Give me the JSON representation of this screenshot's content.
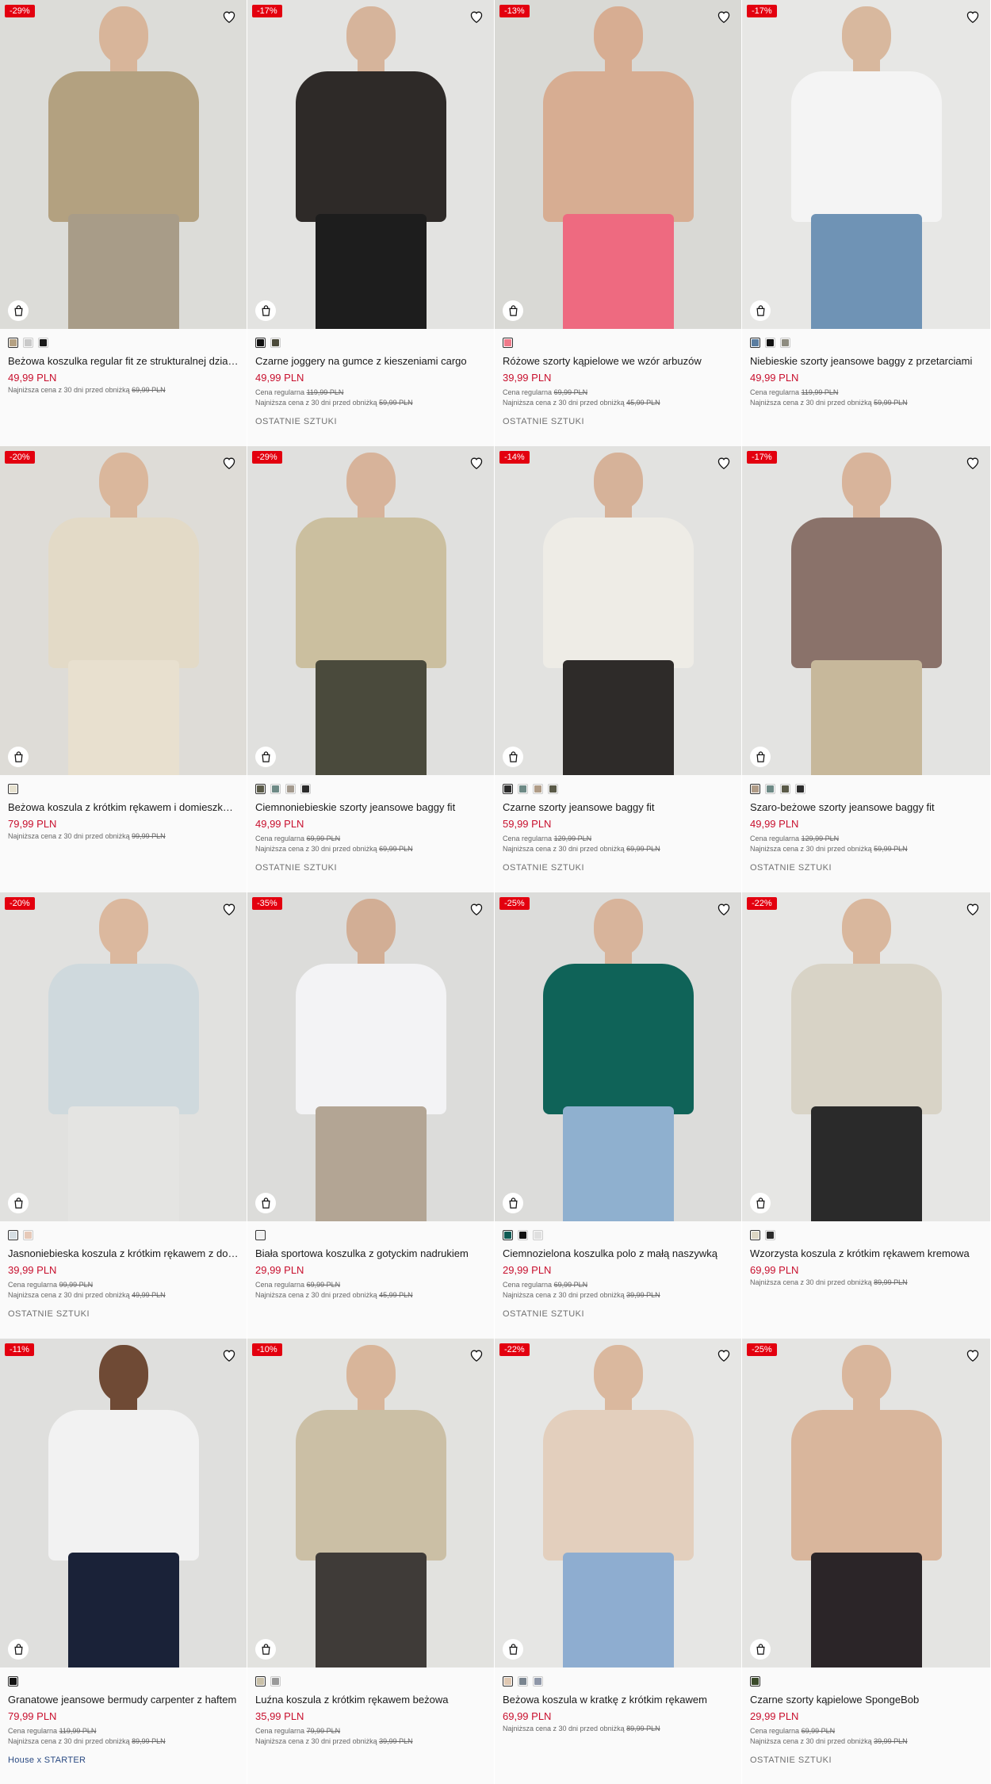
{
  "products": [
    {
      "badge": "-29%",
      "name": "Beżowa koszulka regular fit ze strukturalnej dzianiny",
      "price": "49,99 PLN",
      "regular_label": "",
      "regular_price": "",
      "lowest_label": "Najniższa cena z 30 dni przed obniżką",
      "lowest_price": "69,99 PLN",
      "tag": "",
      "tag_kind": "",
      "swatches": [
        "#b5a183",
        "#c9c9c9",
        "#1a1a1a"
      ],
      "bg": "#dcdcd8",
      "top": "#b3a180",
      "bottom": "#a89c88",
      "skin": "#d8b59a"
    },
    {
      "badge": "-17%",
      "name": "Czarne joggery na gumce z kieszeniami cargo",
      "price": "49,99 PLN",
      "regular_label": "Cena regularna",
      "regular_price": "119,99 PLN",
      "lowest_label": "Najniższa cena z 30 dni przed obniżką",
      "lowest_price": "59,99 PLN",
      "tag": "OSTATNIE SZTUKI",
      "tag_kind": "tag",
      "swatches": [
        "#111111",
        "#4b4a3a"
      ],
      "bg": "#e3e3e1",
      "top": "#2e2a28",
      "bottom": "#1d1d1d",
      "skin": "#d6b49b"
    },
    {
      "badge": "-13%",
      "name": "Różowe szorty kąpielowe we wzór arbuzów",
      "price": "39,99 PLN",
      "regular_label": "Cena regularna",
      "regular_price": "69,99 PLN",
      "lowest_label": "Najniższa cena z 30 dni przed obniżką",
      "lowest_price": "45,99 PLN",
      "tag": "OSTATNIE SZTUKI",
      "tag_kind": "tag",
      "swatches": [
        "#f07a8a"
      ],
      "bg": "#d9d9d5",
      "top": "#d7ad92",
      "bottom": "#ee6a80",
      "skin": "#d7ad92"
    },
    {
      "badge": "-17%",
      "name": "Niebieskie szorty jeansowe baggy z przetarciami",
      "price": "49,99 PLN",
      "regular_label": "Cena regularna",
      "regular_price": "119,99 PLN",
      "lowest_label": "Najniższa cena z 30 dni przed obniżką",
      "lowest_price": "59,99 PLN",
      "tag": "",
      "tag_kind": "",
      "swatches": [
        "#5a7da0",
        "#111111",
        "#8e8c80"
      ],
      "bg": "#e7e7e5",
      "top": "#f4f4f4",
      "bottom": "#6f93b5",
      "skin": "#d8b89e"
    },
    {
      "badge": "-20%",
      "name": "Beżowa koszula z krótkim rękawem i domieszką lnu",
      "price": "79,99 PLN",
      "regular_label": "",
      "regular_price": "",
      "lowest_label": "Najniższa cena z 30 dni przed obniżką",
      "lowest_price": "99,99 PLN",
      "tag": "",
      "tag_kind": "",
      "swatches": [
        "#e6e1cf"
      ],
      "bg": "#dedcd7",
      "top": "#e3dac7",
      "bottom": "#e8e0cf",
      "skin": "#dab79c"
    },
    {
      "badge": "-29%",
      "name": "Ciemnoniebieskie szorty jeansowe baggy fit",
      "price": "49,99 PLN",
      "regular_label": "Cena regularna",
      "regular_price": "69,99 PLN",
      "lowest_label": "Najniższa cena z 30 dni przed obniżką",
      "lowest_price": "69,99 PLN",
      "tag": "OSTATNIE SZTUKI",
      "tag_kind": "tag",
      "swatches": [
        "#5a5a48",
        "#6e8a86",
        "#a49a8e",
        "#2b2b2b"
      ],
      "bg": "#e0e0de",
      "top": "#cbbf9f",
      "bottom": "#4a4a3c",
      "skin": "#d7b39a"
    },
    {
      "badge": "-14%",
      "name": "Czarne szorty jeansowe baggy fit",
      "price": "59,99 PLN",
      "regular_label": "Cena regularna",
      "regular_price": "129,99 PLN",
      "lowest_label": "Najniższa cena z 30 dni przed obniżką",
      "lowest_price": "69,99 PLN",
      "tag": "OSTATNIE SZTUKI",
      "tag_kind": "tag",
      "swatches": [
        "#2b2b2b",
        "#6e8a86",
        "#b09c87",
        "#5a5a48"
      ],
      "bg": "#e2e2e0",
      "top": "#eeece6",
      "bottom": "#2e2b29",
      "skin": "#d6b299"
    },
    {
      "badge": "-17%",
      "name": "Szaro-beżowe szorty jeansowe baggy fit",
      "price": "49,99 PLN",
      "regular_label": "Cena regularna",
      "regular_price": "129,99 PLN",
      "lowest_label": "Najniższa cena z 30 dni przed obniżką",
      "lowest_price": "59,99 PLN",
      "tag": "OSTATNIE SZTUKI",
      "tag_kind": "tag",
      "swatches": [
        "#b09c87",
        "#6e8a86",
        "#5a5a48",
        "#2b2b2b"
      ],
      "bg": "#e3e3e1",
      "top": "#8a726a",
      "bottom": "#c7b89b",
      "skin": "#d8b49b"
    },
    {
      "badge": "-20%",
      "name": "Jasnoniebieska koszula z krótkim rękawem z domieszką lnu",
      "price": "39,99 PLN",
      "regular_label": "Cena regularna",
      "regular_price": "99,99 PLN",
      "lowest_label": "Najniższa cena z 30 dni przed obniżką",
      "lowest_price": "49,99 PLN",
      "tag": "OSTATNIE SZTUKI",
      "tag_kind": "tag",
      "swatches": [
        "#d5dde2",
        "#e6c9b8"
      ],
      "bg": "#e1e1df",
      "top": "#cfd9dd",
      "bottom": "#e4e4e2",
      "skin": "#dbb89e"
    },
    {
      "badge": "-35%",
      "name": "Biała sportowa koszulka z gotyckim nadrukiem",
      "price": "29,99 PLN",
      "regular_label": "Cena regularna",
      "regular_price": "69,99 PLN",
      "lowest_label": "Najniższa cena z 30 dni przed obniżką",
      "lowest_price": "45,99 PLN",
      "tag": "",
      "tag_kind": "",
      "swatches": [
        "#f1f1f1"
      ],
      "bg": "#dcdcda",
      "top": "#f3f3f5",
      "bottom": "#b3a594",
      "skin": "#d2ae95"
    },
    {
      "badge": "-25%",
      "name": "Ciemnozielona koszulka polo z małą naszywką",
      "price": "29,99 PLN",
      "regular_label": "Cena regularna",
      "regular_price": "69,99 PLN",
      "lowest_label": "Najniższa cena z 30 dni przed obniżką",
      "lowest_price": "39,99 PLN",
      "tag": "OSTATNIE SZTUKI",
      "tag_kind": "tag",
      "swatches": [
        "#0f5a54",
        "#111111",
        "#e0e0e0"
      ],
      "bg": "#dcdcda",
      "top": "#0f6358",
      "bottom": "#8fb0cf",
      "skin": "#d8b49b"
    },
    {
      "badge": "-22%",
      "name": "Wzorzysta koszula z krótkim rękawem kremowa",
      "price": "69,99 PLN",
      "regular_label": "",
      "regular_price": "",
      "lowest_label": "Najniższa cena z 30 dni przed obniżką",
      "lowest_price": "89,99 PLN",
      "tag": "",
      "tag_kind": "",
      "swatches": [
        "#dcd6c4",
        "#2b2b2b"
      ],
      "bg": "#e6e6e4",
      "top": "#d8d3c6",
      "bottom": "#2a2a2a",
      "skin": "#d9b79d"
    },
    {
      "badge": "-11%",
      "name": "Granatowe jeansowe bermudy carpenter z haftem",
      "price": "79,99 PLN",
      "regular_label": "Cena regularna",
      "regular_price": "119,99 PLN",
      "lowest_label": "Najniższa cena z 30 dni przed obniżką",
      "lowest_price": "89,99 PLN",
      "tag": "House x STARTER",
      "tag_kind": "brand",
      "swatches": [
        "#111111"
      ],
      "bg": "#dfdfdd",
      "top": "#f2f2f2",
      "bottom": "#1a2238",
      "skin": "#6f4a35"
    },
    {
      "badge": "-10%",
      "name": "Luźna koszula z krótkim rękawem beżowa",
      "price": "35,99 PLN",
      "regular_label": "Cena regularna",
      "regular_price": "79,99 PLN",
      "lowest_label": "Najniższa cena z 30 dni przed obniżką",
      "lowest_price": "39,99 PLN",
      "tag": "",
      "tag_kind": "",
      "swatches": [
        "#c9c0a8",
        "#9a9a9a"
      ],
      "bg": "#e2e2df",
      "top": "#cbbfa5",
      "bottom": "#3f3b38",
      "skin": "#d8b59a"
    },
    {
      "badge": "-22%",
      "name": "Beżowa koszula w kratkę z krótkim rękawem",
      "price": "69,99 PLN",
      "regular_label": "",
      "regular_price": "",
      "lowest_label": "Najniższa cena z 30 dni przed obniżką",
      "lowest_price": "89,99 PLN",
      "tag": "",
      "tag_kind": "",
      "swatches": [
        "#e0c8b2",
        "#7a8590",
        "#8f97a8"
      ],
      "bg": "#e6e6e4",
      "top": "#e3cfbd",
      "bottom": "#8eadd0",
      "skin": "#dab89e"
    },
    {
      "badge": "-25%",
      "name": "Czarne szorty kąpielowe SpongeBob",
      "price": "29,99 PLN",
      "regular_label": "Cena regularna",
      "regular_price": "69,99 PLN",
      "lowest_label": "Najniższa cena z 30 dni przed obniżką",
      "lowest_price": "39,99 PLN",
      "tag": "OSTATNIE SZTUKI",
      "tag_kind": "tag",
      "swatches": [
        "#3a4a2a"
      ],
      "bg": "#e4e4e2",
      "top": "#d9b69c",
      "bottom": "#2b2528",
      "skin": "#d9b69c"
    }
  ]
}
